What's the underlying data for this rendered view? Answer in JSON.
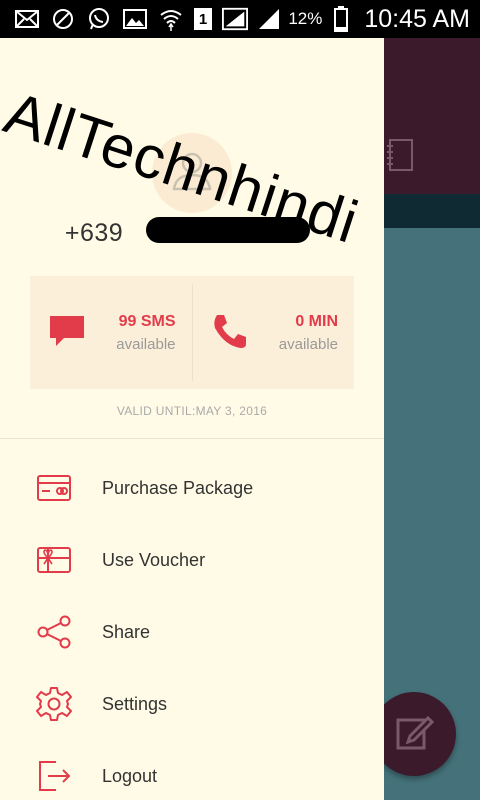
{
  "status_bar": {
    "battery_percent": "12%",
    "time": "10:45 AM",
    "sim_indicator": "1",
    "icons": [
      "mail-icon",
      "no-sim-icon",
      "whatsapp-icon",
      "image-icon",
      "wifi-icon",
      "sim-1-icon",
      "signal-icon",
      "signal-2-icon",
      "battery-icon"
    ]
  },
  "drawer": {
    "watermark": "AllTechnhindi",
    "phone_number": "+639",
    "stats": {
      "sms_value": "99 SMS",
      "sms_label": "available",
      "min_value": "0 MIN",
      "min_label": "available"
    },
    "valid_until": "VALID UNTIL:MAY 3, 2016",
    "menu": [
      {
        "label": "Purchase Package",
        "icon": "card-icon"
      },
      {
        "label": "Use Voucher",
        "icon": "gift-card-icon"
      },
      {
        "label": "Share",
        "icon": "share-icon"
      },
      {
        "label": "Settings",
        "icon": "gear-icon"
      },
      {
        "label": "Logout",
        "icon": "logout-icon"
      }
    ]
  },
  "colors": {
    "accent": "#e23b4a",
    "drawer_bg": "#fffbe6",
    "app_teal": "#45727a",
    "app_dark": "#3b1a2c"
  }
}
